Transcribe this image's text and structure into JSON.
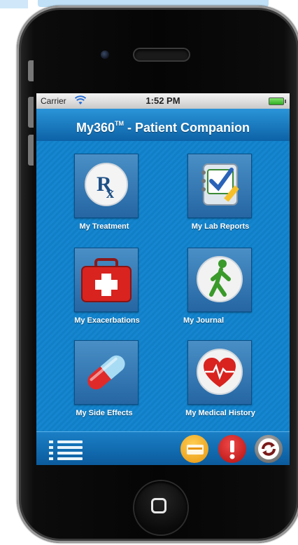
{
  "status_bar": {
    "carrier": "Carrier",
    "time": "1:52 PM"
  },
  "header": {
    "title_prefix": "My360",
    "trademark": "TM",
    "title_suffix": " -  Patient Companion"
  },
  "menu": {
    "items": [
      {
        "label": "My Treatment",
        "icon": "rx-icon"
      },
      {
        "label": "My Lab Reports",
        "icon": "clipboard-check-icon"
      },
      {
        "label": "My Exacerbations",
        "icon": "first-aid-kit-icon"
      },
      {
        "label": "My Journal",
        "icon": "walking-person-icon"
      },
      {
        "label": "My Side Effects",
        "icon": "pill-capsule-icon"
      },
      {
        "label": "My Medical History",
        "icon": "heart-pulse-icon"
      }
    ]
  },
  "toolbar": {
    "buttons": [
      {
        "icon": "list-icon"
      },
      {
        "icon": "orange-card-icon"
      },
      {
        "icon": "alert-icon"
      },
      {
        "icon": "sync-icon"
      }
    ]
  },
  "colors": {
    "screen_bg": "#1080c8",
    "title_bar": "#0d62a6",
    "alert_red": "#d21c1c",
    "accent_orange": "#f0a418"
  }
}
